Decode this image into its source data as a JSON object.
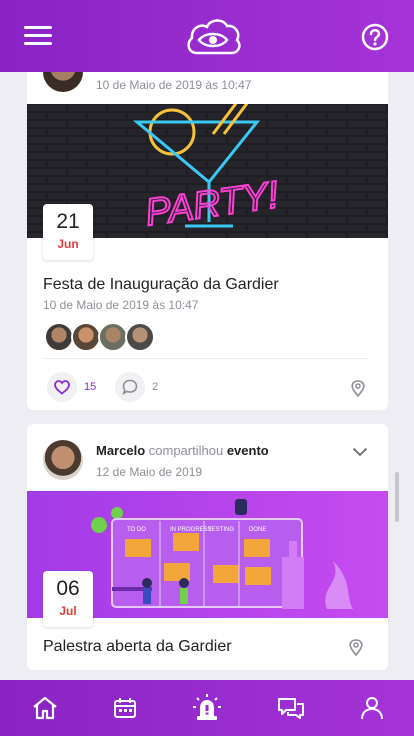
{
  "app": {
    "brand_icon": "cloud-eye-logo",
    "colors": {
      "primary": "#9b2bd0",
      "like": "#8a2bd6",
      "month": "#e23a3a"
    }
  },
  "topbar": {
    "menu_icon": "menu-icon",
    "help_icon": "help-icon"
  },
  "feed": {
    "posts": [
      {
        "posted_at": "10 de Maio de 2019 às 10:47",
        "event_day": "21",
        "event_month": "Jun",
        "event_title": "Festa de Inauguração da Gardier",
        "event_datetime": "10 de Maio de 2019 às 10:47",
        "banner_text": "PARTY!",
        "likes": "15",
        "comments": "2"
      },
      {
        "author": "Marcelo",
        "action": "compartilhou",
        "object": "evento",
        "posted_at": "12 de Maio de 2019",
        "event_day": "06",
        "event_month": "Jul",
        "event_title": "Palestra aberta da Gardier",
        "board_labels": [
          "TO DO",
          "IN PROGRESS",
          "TESTING",
          "DONE"
        ]
      }
    ]
  },
  "bottom_nav": {
    "items": [
      "home-icon",
      "calendar-icon",
      "alarm-icon",
      "chat-icon",
      "profile-icon"
    ]
  }
}
